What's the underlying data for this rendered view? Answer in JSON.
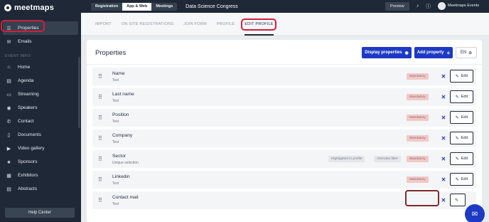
{
  "sidebar": {
    "logo": "meetmaps",
    "top_items": [
      {
        "label": "Properties",
        "icon": "list-icon"
      },
      {
        "label": "Emails",
        "icon": "mail-icon"
      }
    ],
    "section_title": "EVENT INFO",
    "event_items": [
      {
        "label": "Home",
        "icon": "home-icon"
      },
      {
        "label": "Agenda",
        "icon": "book-icon"
      },
      {
        "label": "Streaming",
        "icon": "screen-icon"
      },
      {
        "label": "Speakers",
        "icon": "speaker-icon"
      },
      {
        "label": "Contact",
        "icon": "contact-icon"
      },
      {
        "label": "Documents",
        "icon": "document-icon"
      },
      {
        "label": "Video gallery",
        "icon": "video-icon"
      },
      {
        "label": "Sponsors",
        "icon": "sponsor-icon"
      },
      {
        "label": "Exhibitors",
        "icon": "exhibitor-icon"
      },
      {
        "label": "Abstracts",
        "icon": "abstract-icon"
      }
    ],
    "help_center": "Help Center"
  },
  "topbar": {
    "tabs": [
      "Registration",
      "App & Web",
      "Meetings"
    ],
    "active_tab": "App & Web",
    "event_title": "Data Science Congress",
    "preview": "Preview",
    "account_name": "Meetmaps Events"
  },
  "subtabs": {
    "items": [
      "IMPORT",
      "ON SITE REGISTRATIONS",
      "JOIN FORM",
      "PROFILE",
      "EDIT PROFILE"
    ],
    "active": "EDIT PROFILE"
  },
  "main": {
    "title": "Properties",
    "display_button": "Display properties",
    "add_button": "Add property",
    "language": "EN",
    "edit_label": "Edit",
    "mandatory_label": "Mandatory",
    "properties": [
      {
        "name": "Name",
        "type": "Text",
        "mandatory": true
      },
      {
        "name": "Last name",
        "type": "Text",
        "mandatory": true
      },
      {
        "name": "Position",
        "type": "Text",
        "mandatory": true
      },
      {
        "name": "Company",
        "type": "Text",
        "mandatory": true
      },
      {
        "name": "Sector",
        "type": "Unique selection",
        "mandatory": true,
        "tags": [
          "Highlighted in profile",
          "Attendee filter"
        ]
      },
      {
        "name": "Linkedin",
        "type": "Text",
        "mandatory": true
      },
      {
        "name": "Contact mail",
        "type": "Text",
        "mandatory": false
      }
    ]
  },
  "colors": {
    "sidebar_bg": "#1e2837",
    "primary": "#1d3ac4",
    "mandatory_bg": "#f3c8c8",
    "highlight_ring": "#d21f3c"
  }
}
